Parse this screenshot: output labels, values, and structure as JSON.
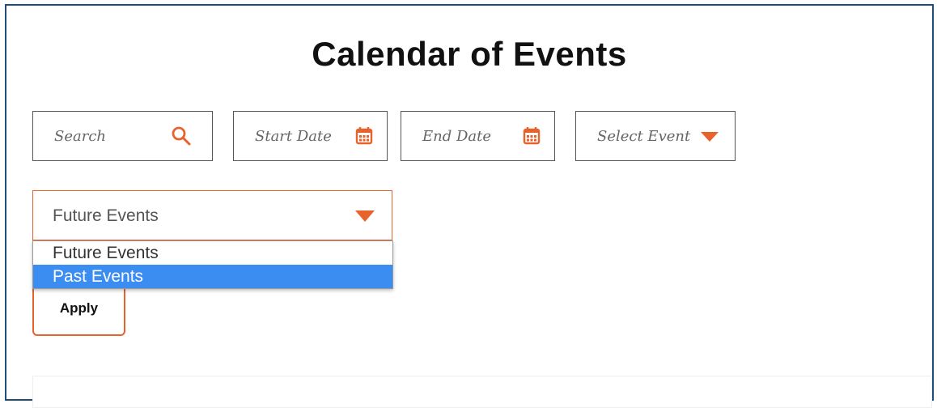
{
  "page": {
    "title": "Calendar of Events"
  },
  "filters": {
    "search_placeholder": "Search",
    "start_date_placeholder": "Start Date",
    "end_date_placeholder": "End Date",
    "event_select_placeholder": "Select Event"
  },
  "time_filter": {
    "selected": "Future Events",
    "options": [
      {
        "label": "Future Events",
        "highlighted": false
      },
      {
        "label": "Past Events",
        "highlighted": true
      }
    ]
  },
  "apply_label": "Apply",
  "colors": {
    "accent": "#e8622c",
    "frame": "#1f4e79",
    "highlight": "#3b8df2"
  },
  "icons": {
    "search": "search-icon",
    "calendar": "calendar-icon",
    "dropdown": "triangle-down-icon"
  }
}
